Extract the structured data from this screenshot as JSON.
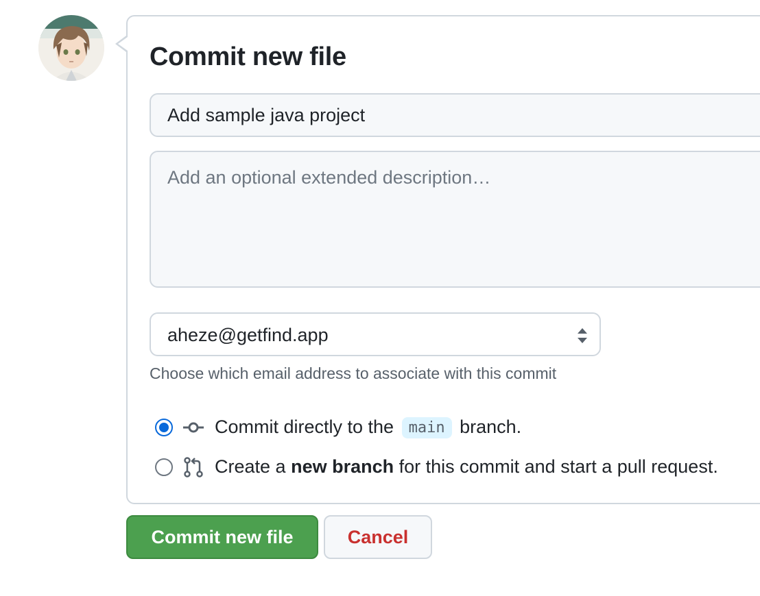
{
  "commit_form": {
    "title": "Commit new file",
    "summary_value": "Add sample java project",
    "description_placeholder": "Add an optional extended description…",
    "email_selected": "aheze@getfind.app",
    "email_hint": "Choose which email address to associate with this commit",
    "option_direct": {
      "prefix": "Commit directly to the",
      "branch": "main",
      "suffix": "branch.",
      "checked": true
    },
    "option_new_branch": {
      "prefix": "Create a",
      "bold": "new branch",
      "suffix": "for this commit and start a pull request.",
      "checked": false
    },
    "commit_button": "Commit new file",
    "cancel_button": "Cancel"
  },
  "colors": {
    "primary_button": "#4ca04f",
    "cancel_text": "#c9312f",
    "radio_accent": "#0969da",
    "branch_badge": "#ddf4ff"
  },
  "icons": {
    "direct_commit": "git-commit-icon",
    "new_branch": "git-pull-request-icon",
    "select_caret": "select-caret-icon"
  }
}
